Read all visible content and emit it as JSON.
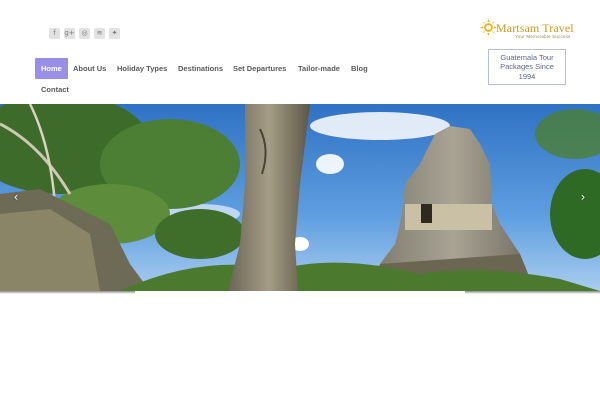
{
  "social": {
    "icons": [
      {
        "name": "facebook-icon",
        "glyph": "f"
      },
      {
        "name": "google-plus-icon",
        "glyph": "g+"
      },
      {
        "name": "instagram-icon",
        "glyph": "◎"
      },
      {
        "name": "rss-icon",
        "glyph": "≋"
      },
      {
        "name": "twitter-icon",
        "glyph": "✦"
      }
    ]
  },
  "logo": {
    "name": "Martsam Travel",
    "tagline": "Your Memorable Success"
  },
  "tagline_box": "Guatemala Tour Packages Since 1994",
  "nav": {
    "items": [
      {
        "label": "Home",
        "active": true
      },
      {
        "label": "About Us",
        "active": false
      },
      {
        "label": "Holiday Types",
        "active": false
      },
      {
        "label": "Destinations",
        "active": false
      },
      {
        "label": "Set Departures",
        "active": false
      },
      {
        "label": "Tailor-made",
        "active": false
      },
      {
        "label": "Blog",
        "active": false
      },
      {
        "label": "Contact",
        "active": false
      }
    ]
  },
  "hero": {
    "prev_icon": "‹",
    "next_icon": "›"
  },
  "colors": {
    "nav_active_bg": "#9a8fe8",
    "logo_gold": "#c99a1c",
    "tagline_border": "#b9bed2"
  }
}
